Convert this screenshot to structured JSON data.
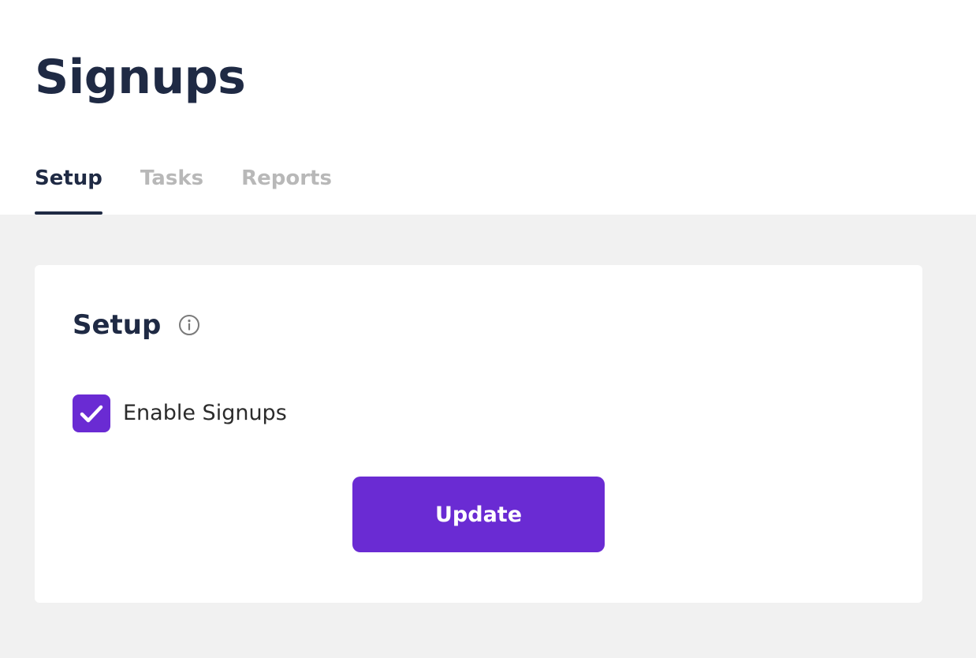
{
  "page": {
    "title": "Signups"
  },
  "tabs": [
    {
      "label": "Setup",
      "active": true
    },
    {
      "label": "Tasks",
      "active": false
    },
    {
      "label": "Reports",
      "active": false
    }
  ],
  "setup_card": {
    "title": "Setup",
    "info_icon": "info-circle-icon",
    "enable_signups": {
      "label": "Enable Signups",
      "checked": true,
      "icon": "checkmark-icon"
    },
    "update_button_label": "Update"
  },
  "colors": {
    "title_navy": "#1f2a44",
    "accent_purple": "#6a2bd3",
    "inactive_tab_gray": "#b8b8b8",
    "page_background": "#f1f1f1"
  }
}
